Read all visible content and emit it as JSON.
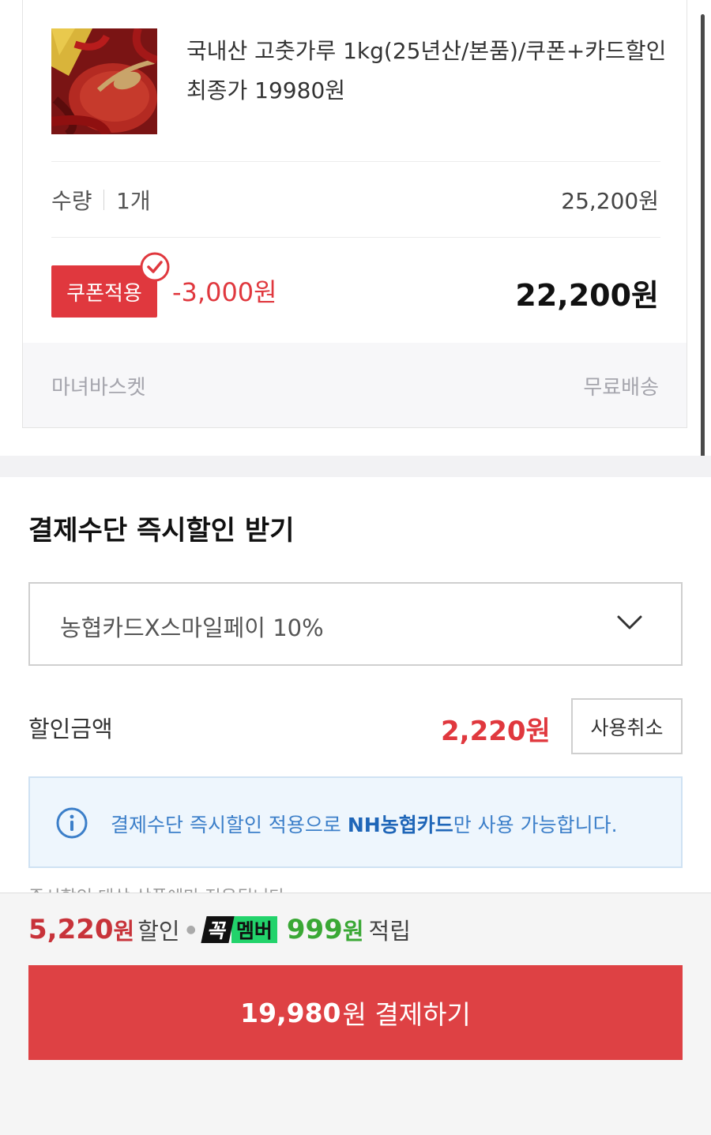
{
  "product": {
    "title": "국내산 고춧가루 1kg(25년산/본품)/쿠폰+카드할인 최종가 19980원",
    "quantity_label": "수량",
    "quantity_value": "1개",
    "subtotal": "25,200원",
    "coupon_badge": "쿠폰적용",
    "coupon_discount": "-3,000원",
    "item_total": "22,200원",
    "seller": "마녀바스켓",
    "shipping": "무료배송"
  },
  "payment": {
    "heading": "결제수단 즉시할인 받기",
    "selected_method": "농협카드X스마일페이 10%",
    "discount_label": "할인금액",
    "discount_amount": "2,220원",
    "cancel_button": "사용취소",
    "info_prefix": "결제수단 즉시할인 적용으로 ",
    "info_bold": "NH농협카드",
    "info_suffix": "만 사용 가능합니다.",
    "partial_note": "즉시할인 대상 상품에만 적용됩니다."
  },
  "summary": {
    "discount_number": "5,220",
    "discount_unit": "원",
    "discount_label": "할인",
    "member_k": "꼭",
    "member_word": "멤버",
    "points_number": "999",
    "points_unit": "원",
    "points_label": "적립",
    "pay_amount": "19,980",
    "pay_label": "원 결제하기"
  },
  "colors": {
    "accent_red": "#de4144",
    "member_green": "#22d36b",
    "points_green": "#3aa835",
    "info_blue": "#3c7fc9"
  },
  "icons": {
    "coupon_check": "check-circle-icon",
    "dropdown": "chevron-down-icon",
    "info": "info-circle-icon"
  }
}
